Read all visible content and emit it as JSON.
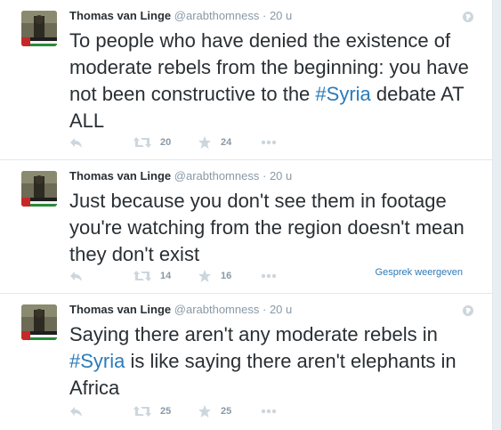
{
  "tweets": [
    {
      "fullname": "Thomas van Linge",
      "username": "@arabthomness",
      "separator": "·",
      "time": "20 u",
      "text_before": "To people who have denied the existence of moderate rebels from the beginning: you have not been constructive to the ",
      "hashtag": "#Syria",
      "text_after": " debate AT ALL",
      "retweets": "20",
      "favorites": "24",
      "conversation": ""
    },
    {
      "fullname": "Thomas van Linge",
      "username": "@arabthomness",
      "separator": "·",
      "time": "20 u",
      "text_before": "Just because you don't see them in footage you're watching from the region doesn't mean they don't exist",
      "hashtag": "",
      "text_after": "",
      "retweets": "14",
      "favorites": "16",
      "conversation": "Gesprek weergeven"
    },
    {
      "fullname": "Thomas van Linge",
      "username": "@arabthomness",
      "separator": "·",
      "time": "20 u",
      "text_before": "Saying there aren't any moderate rebels in ",
      "hashtag": "#Syria",
      "text_after": " is like saying there aren't elephants in Africa",
      "retweets": "25",
      "favorites": "25",
      "conversation": ""
    }
  ],
  "icons": {
    "reply": "reply-icon",
    "retweet": "retweet-icon",
    "favorite": "star-icon",
    "more": "more-icon",
    "globe": "globe-icon"
  },
  "colors": {
    "link": "#2b7bb9",
    "muted": "#8899a6",
    "text": "#292f33"
  }
}
